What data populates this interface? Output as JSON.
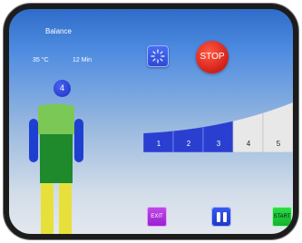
{
  "status": {
    "mode": "Balance",
    "temperature": "35 °C",
    "time": "12 Min"
  },
  "zone_badge": "4",
  "controls": {
    "stop_label": "STOP",
    "heat_icon": "sunburst-icon",
    "exit_label": "EXIT",
    "pause_icon": "pause-icon",
    "start_label": "START"
  },
  "intensity": {
    "labels": [
      "1",
      "2",
      "3",
      "4",
      "5"
    ],
    "current": 3,
    "max": 5
  },
  "colors": {
    "active_level": "#2a3fd0",
    "inactive_level": "#e8e8e8",
    "head_and_torso_upper": "#7bc856",
    "torso_lower": "#1f8a2c",
    "arms": "#1f3fd0",
    "legs": "#e8e03a",
    "stop": "#e3281d",
    "exit": "#b12ee0",
    "start": "#19c935"
  }
}
